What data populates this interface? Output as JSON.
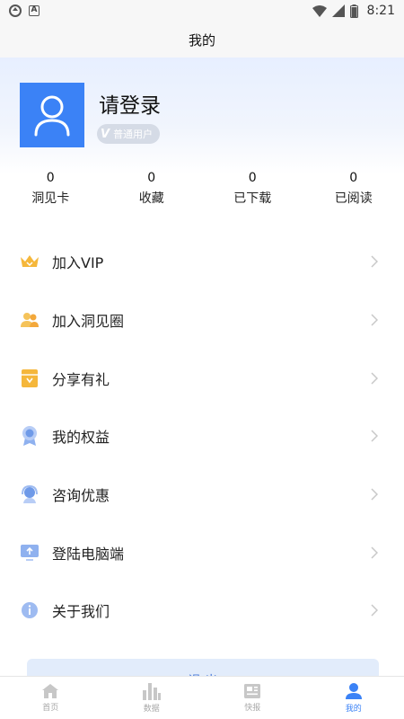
{
  "status_bar": {
    "time": "8:21",
    "app_icon_letter": "A"
  },
  "header": {
    "title": "我的"
  },
  "profile": {
    "login_prompt": "请登录",
    "badge_letter": "V",
    "badge_label": "普通用户"
  },
  "stats": [
    {
      "value": "0",
      "label": "洞见卡"
    },
    {
      "value": "0",
      "label": "收藏"
    },
    {
      "value": "0",
      "label": "已下载"
    },
    {
      "value": "0",
      "label": "已阅读"
    }
  ],
  "menu": [
    {
      "label": "加入VIP",
      "icon": "crown-icon"
    },
    {
      "label": "加入洞见圈",
      "icon": "community-icon"
    },
    {
      "label": "分享有礼",
      "icon": "gift-icon"
    },
    {
      "label": "我的权益",
      "icon": "medal-icon"
    },
    {
      "label": "咨询优惠",
      "icon": "headset-icon"
    },
    {
      "label": "登陆电脑端",
      "icon": "monitor-icon"
    },
    {
      "label": "关于我们",
      "icon": "info-icon"
    }
  ],
  "logout": {
    "label": "退 出"
  },
  "tabs": [
    {
      "label": "首页",
      "icon": "home-icon",
      "active": false
    },
    {
      "label": "数据",
      "icon": "chart-icon",
      "active": false
    },
    {
      "label": "快报",
      "icon": "news-icon",
      "active": false
    },
    {
      "label": "我的",
      "icon": "profile-icon",
      "active": true
    }
  ],
  "colors": {
    "accent": "#3b82f6",
    "crown": "#f5b73b",
    "inactive_tab": "#c7c7c7"
  }
}
